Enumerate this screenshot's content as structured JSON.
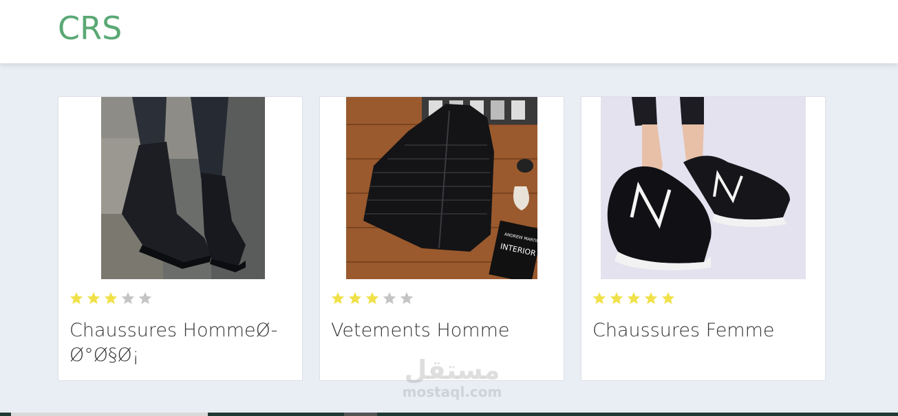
{
  "brand": {
    "name": "CRS",
    "color": "#5aa874"
  },
  "products": [
    {
      "title": "Chaussures HommeØ-Ø°Ø§Ø¡",
      "rating": 3,
      "max_rating": 5,
      "image": "men-boots-photo"
    },
    {
      "title": "Vetements Homme",
      "rating": 3,
      "max_rating": 5,
      "image": "men-puffer-vest-photo",
      "image_text": {
        "book_author": "ANDREW MARTIN",
        "book_title": "INTERIOR DESIGN REVIEW"
      }
    },
    {
      "title": "Chaussures Femme",
      "rating": 5,
      "max_rating": 5,
      "image": "women-sneakers-photo"
    }
  ],
  "colors": {
    "star_on": "#f0e14a",
    "star_off": "#c4c4c4",
    "page_bg": "#e9edf4"
  },
  "watermark": {
    "logo": "مستقل",
    "url": "mostaql.com"
  }
}
